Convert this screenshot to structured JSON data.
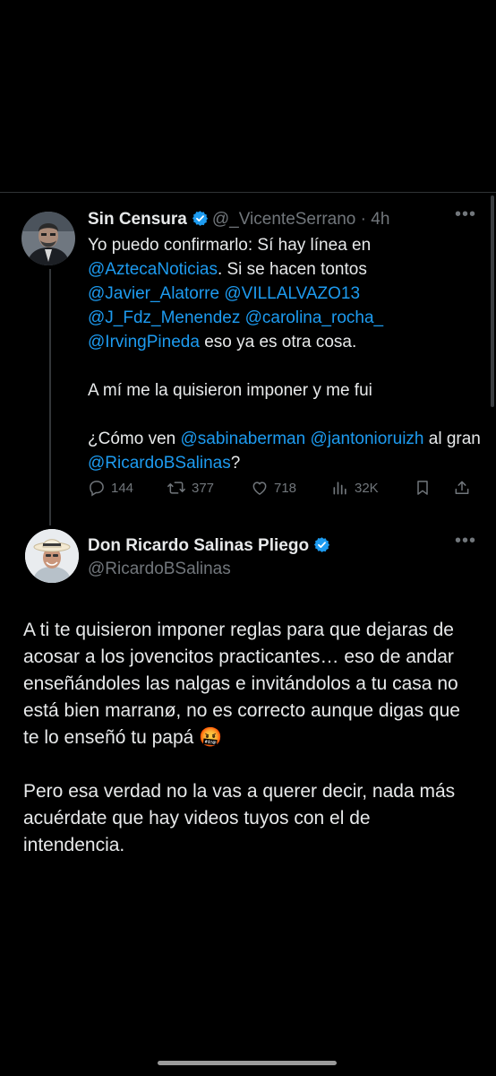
{
  "reply_tweet": {
    "display_name": "Sin Censura",
    "handle": "@_VicenteSerrano",
    "time": "· 4h",
    "line1": "Yo puedo confirmarlo: Sí hay línea en",
    "m_azteca": "@AztecaNoticias",
    "line2": ". Si se hacen tontos",
    "m_javier": "@Javier_Alatorre",
    "m_villalvazo": "@VILLALVAZO13",
    "m_jfdz": "@J_Fdz_Menendez",
    "m_carolina": "@carolina_rocha_",
    "m_irving": "@IrvingPineda",
    "line3": " eso ya es otra cosa.",
    "para2": "A mí me la quisieron imponer y me fui",
    "line4": "¿Cómo ven ",
    "m_sabina": "@sabinaberman",
    "m_jantonio": "@jantonioruizh",
    "line5": " al gran ",
    "m_ricardo": "@RicardoBSalinas",
    "line6": "?",
    "stats": {
      "replies": "144",
      "retweets": "377",
      "likes": "718",
      "views": "32K"
    }
  },
  "main_tweet": {
    "display_name": "Don Ricardo Salinas Pliego",
    "handle": "@RicardoBSalinas",
    "para1": "A ti te quisieron imponer reglas para que dejaras de acosar a los jovencitos practicantes… eso de andar enseñándoles las nalgas e invitándolos a tu casa no está bien marranø, no es correcto aunque digas que te lo enseñó tu papá 🤬",
    "para2": "Pero esa verdad no la vas a querer decir, nada más acuérdate que hay videos tuyos con el de intendencia."
  },
  "colors": {
    "background": "#000000",
    "text": "#e7e9ea",
    "secondary": "#71767b",
    "link": "#1d9bf0",
    "verified": "#1d9bf0"
  },
  "icons": [
    "verified-badge-icon",
    "more-icon",
    "reply-icon",
    "retweet-icon",
    "like-icon",
    "views-icon",
    "bookmark-icon",
    "share-icon"
  ]
}
